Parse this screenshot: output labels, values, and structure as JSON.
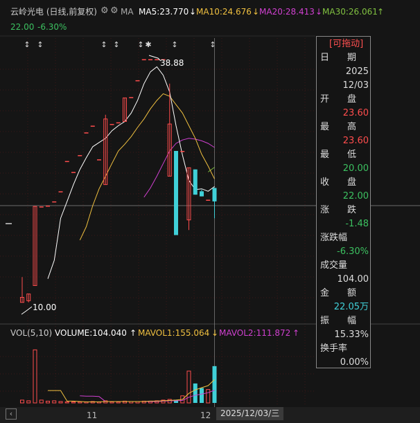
{
  "header": {
    "title": "云岭光电 (日线,前复权)",
    "indicator": "MA",
    "ma5": "MA5:23.770",
    "ma10": "MA10:24.676",
    "ma20": "MA20:28.413",
    "ma30": "MA30:26.061",
    "close": "22.00",
    "change_pct": "-6.30%",
    "arrow_down": "↓",
    "arrow_up": "↑"
  },
  "price_annotations": {
    "high": "38.88",
    "low": "10.00"
  },
  "volume_header": {
    "title": "VOL(5,10)",
    "volume": "VOLUME:104.040",
    "mavol1": "MAVOL1:155.064",
    "mavol2": "MAVOL2:111.872",
    "arrow_up": "↑",
    "arrow_down": "↓"
  },
  "x_axis": {
    "labels": [
      "11",
      "12"
    ],
    "crosshair_date": "2025/12/03/三"
  },
  "info_panel": {
    "title": "[可拖动]",
    "date_label": "日　　期",
    "date_year": "2025",
    "date_md": "12/03",
    "open_label": "开　　盘",
    "open": "23.60",
    "high_label": "最　　高",
    "high": "23.60",
    "low_label": "最　　低",
    "low": "20.00",
    "close_label": "收　　盘",
    "close": "22.00",
    "change_label": "涨　　跌",
    "change": "-1.48",
    "change_pct_label": "涨跌幅",
    "change_pct": "-6.30%",
    "volume_label": "成交量",
    "volume": "104.00",
    "amount_label": "金　　额",
    "amount": "22.05万",
    "amplitude_label": "振　　幅",
    "amplitude": "15.33%",
    "turnover_label": "换手率",
    "turnover": "0.00%"
  },
  "colors": {
    "up": "#ff4d4d",
    "down": "#40d0d8",
    "ma5": "#ffffff",
    "ma10": "#f0c040",
    "ma20": "#d040d0",
    "ma30": "#80c040",
    "vol_ma1": "#f0c040",
    "vol_ma2": "#d040d0",
    "grid": "#3a1818"
  },
  "chart_data": {
    "type": "candlestick",
    "price_range": [
      8.5,
      41
    ],
    "volume_range": [
      0,
      180
    ],
    "candles": [
      {
        "o": 10.0,
        "c": 10.6,
        "h": 13.0,
        "l": 10.0,
        "v": 8
      },
      {
        "o": 10.2,
        "c": 11.0,
        "h": 11.0,
        "l": 10.0,
        "v": 6
      },
      {
        "o": 12.0,
        "c": 21.4,
        "h": 21.4,
        "l": 12.0,
        "v": 150
      },
      {
        "o": 21.4,
        "c": 21.4,
        "h": 21.4,
        "l": 21.4,
        "v": 8
      },
      {
        "o": 21.5,
        "c": 21.5,
        "h": 21.5,
        "l": 21.5,
        "v": 5
      },
      {
        "o": 22.0,
        "c": 22.0,
        "h": 22.0,
        "l": 22.0,
        "v": 6
      },
      {
        "o": 23.2,
        "c": 23.2,
        "h": 23.2,
        "l": 23.2,
        "v": 4
      },
      {
        "o": 26.8,
        "c": 26.8,
        "h": 26.8,
        "l": 26.8,
        "v": 3
      },
      {
        "o": 25.5,
        "c": 25.5,
        "h": 25.5,
        "l": 25.5,
        "v": 3
      },
      {
        "o": 27.5,
        "c": 27.5,
        "h": 27.5,
        "l": 27.5,
        "v": 3
      },
      {
        "o": 30.2,
        "c": 30.2,
        "h": 30.2,
        "l": 30.2,
        "v": 3
      },
      {
        "o": 31.0,
        "c": 31.0,
        "h": 31.0,
        "l": 31.0,
        "v": 4
      },
      {
        "o": 27.0,
        "c": 27.0,
        "h": 27.0,
        "l": 27.0,
        "v": 3
      },
      {
        "o": 24.0,
        "c": 31.8,
        "h": 32.3,
        "l": 24.0,
        "v": 6
      },
      {
        "o": 31.2,
        "c": 31.2,
        "h": 31.2,
        "l": 31.2,
        "v": 3
      },
      {
        "o": 31.4,
        "c": 31.4,
        "h": 31.4,
        "l": 31.4,
        "v": 3
      },
      {
        "o": 31.5,
        "c": 34.3,
        "h": 34.3,
        "l": 31.5,
        "v": 5
      },
      {
        "o": 34.4,
        "c": 34.4,
        "h": 34.4,
        "l": 34.4,
        "v": 4
      },
      {
        "o": 36.4,
        "c": 36.4,
        "h": 36.4,
        "l": 36.4,
        "v": 4
      },
      {
        "o": 38.9,
        "c": 38.9,
        "h": 38.9,
        "l": 38.9,
        "v": 5
      },
      {
        "o": 38.9,
        "c": 38.9,
        "h": 38.9,
        "l": 38.9,
        "v": 5
      },
      {
        "o": 38.9,
        "c": 38.9,
        "h": 38.9,
        "l": 38.9,
        "v": 6
      },
      {
        "o": 38.9,
        "c": 38.9,
        "h": 38.9,
        "l": 38.9,
        "v": 8
      },
      {
        "o": 25.0,
        "c": 31.2,
        "h": 36.0,
        "l": 25.0,
        "v": 10
      },
      {
        "o": 28.0,
        "c": 18.0,
        "h": 28.0,
        "l": 18.0,
        "v": 9
      },
      {
        "o": 28.0,
        "c": 28.0,
        "h": 28.0,
        "l": 28.0,
        "v": 20
      },
      {
        "o": 19.8,
        "c": 26.0,
        "h": 26.0,
        "l": 18.6,
        "v": 90
      },
      {
        "o": 25.8,
        "c": 22.8,
        "h": 25.8,
        "l": 22.8,
        "v": 55
      },
      {
        "o": 23.2,
        "c": 22.6,
        "h": 23.4,
        "l": 22.6,
        "v": 42
      },
      {
        "o": 22.2,
        "c": 22.2,
        "h": 22.2,
        "l": 22.2,
        "v": 38
      },
      {
        "o": 23.6,
        "c": 22.0,
        "h": 23.6,
        "l": 20.0,
        "v": 104
      }
    ],
    "ma5": [
      null,
      null,
      null,
      null,
      12.8,
      15.0,
      20.0,
      22.0,
      24.0,
      25.8,
      27.2,
      28.5,
      29.0,
      29.5,
      30.4,
      31.0,
      31.5,
      32.5,
      34.0,
      36.0,
      37.4,
      38.0,
      37.0,
      35.0,
      31.0,
      27.5,
      24.5,
      23.4,
      23.5,
      23.2,
      23.77
    ],
    "ma10": [
      null,
      null,
      null,
      null,
      null,
      null,
      null,
      null,
      null,
      17.4,
      19.0,
      21.5,
      23.5,
      25.0,
      26.5,
      28.0,
      28.8,
      29.7,
      30.8,
      31.8,
      33.0,
      34.0,
      34.8,
      34.5,
      33.5,
      32.5,
      31.0,
      29.5,
      27.6,
      26.2,
      24.676
    ],
    "ma20": [
      null,
      null,
      null,
      null,
      null,
      null,
      null,
      null,
      null,
      null,
      null,
      null,
      null,
      null,
      null,
      null,
      null,
      null,
      null,
      22.5,
      23.6,
      25.0,
      26.5,
      28.0,
      28.9,
      29.3,
      29.5,
      29.4,
      29.2,
      28.9,
      28.413
    ],
    "ma30": [
      null,
      null,
      null,
      null,
      null,
      null,
      null,
      null,
      null,
      null,
      null,
      null,
      null,
      null,
      null,
      null,
      null,
      null,
      null,
      null,
      null,
      null,
      null,
      null,
      null,
      null,
      null,
      null,
      null,
      25.5,
      26.061
    ],
    "vol_ma1": [
      null,
      null,
      null,
      null,
      35,
      35,
      35,
      5,
      5,
      4,
      3,
      3,
      3,
      4,
      4,
      4,
      4,
      4,
      4,
      4,
      5,
      5,
      6,
      7,
      8,
      10,
      27,
      37,
      43,
      49,
      66
    ],
    "vol_ma2": [
      null,
      null,
      null,
      null,
      null,
      null,
      null,
      null,
      null,
      20,
      19,
      19,
      18,
      4,
      4,
      4,
      4,
      4,
      4,
      4,
      4,
      4,
      5,
      6,
      6,
      7,
      16,
      22,
      25,
      29,
      36
    ]
  }
}
